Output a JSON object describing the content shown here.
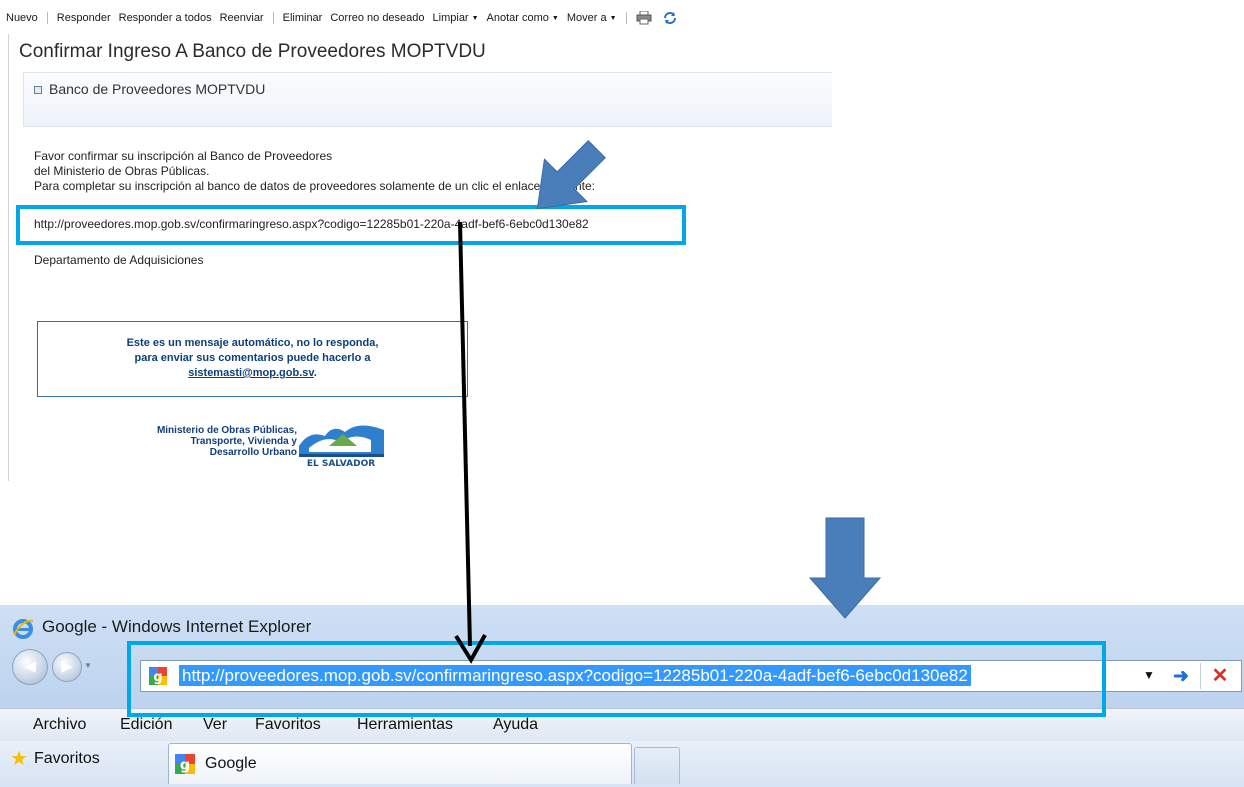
{
  "toolbar": {
    "nuevo": "Nuevo",
    "responder": "Responder",
    "responder_todos": "Responder a todos",
    "reenviar": "Reenviar",
    "eliminar": "Eliminar",
    "correo_no_deseado": "Correo no deseado",
    "limpiar": "Limpiar",
    "anotar_como": "Anotar como",
    "mover_a": "Mover a",
    "print_icon": "printer-icon",
    "refresh_icon": "refresh-icon"
  },
  "email": {
    "subject": "Confirmar Ingreso A Banco de Proveedores MOPTVDU",
    "header": "Banco de Proveedores MOPTVDU",
    "body_line1": "Favor confirmar su inscripción al Banco de Proveedores",
    "body_line2": "del Ministerio de Obras Públicas.",
    "body_line3": "Para completar su inscripción al banco de datos de proveedores solamente de un clic el enlace siguiente:",
    "link": "http://proveedores.mop.gob.sv/confirmaringreso.aspx?codigo=12285b01-220a-4adf-bef6-6ebc0d130e82",
    "department": "Departamento de Adquisiciones",
    "notice_line1": "Este es un mensaje automático, no lo responda,",
    "notice_line2": "para enviar sus comentarios puede hacerlo a",
    "notice_email": "sistemasti@mop.gob.sv",
    "notice_period": ".",
    "ministry_line1": "Ministerio de Obras Públicas,",
    "ministry_line2": "Transporte, Vivienda y",
    "ministry_line3": "Desarrollo Urbano",
    "logo_text": "EL SALVADOR"
  },
  "browser": {
    "title": "Google - Windows Internet Explorer",
    "address": "http://proveedores.mop.gob.sv/confirmaringreso.aspx?codigo=12285b01-220a-4adf-bef6-6ebc0d130e82",
    "menu": [
      "Archivo",
      "Edición",
      "Ver",
      "Favoritos",
      "Herramientas",
      "Ayuda"
    ],
    "favorites_label": "Favoritos",
    "tab_label": "Google"
  },
  "colors": {
    "highlight_box": "#00a8e8",
    "annotation_arrow": "#4a7ebb",
    "selection": "#3399ff"
  }
}
